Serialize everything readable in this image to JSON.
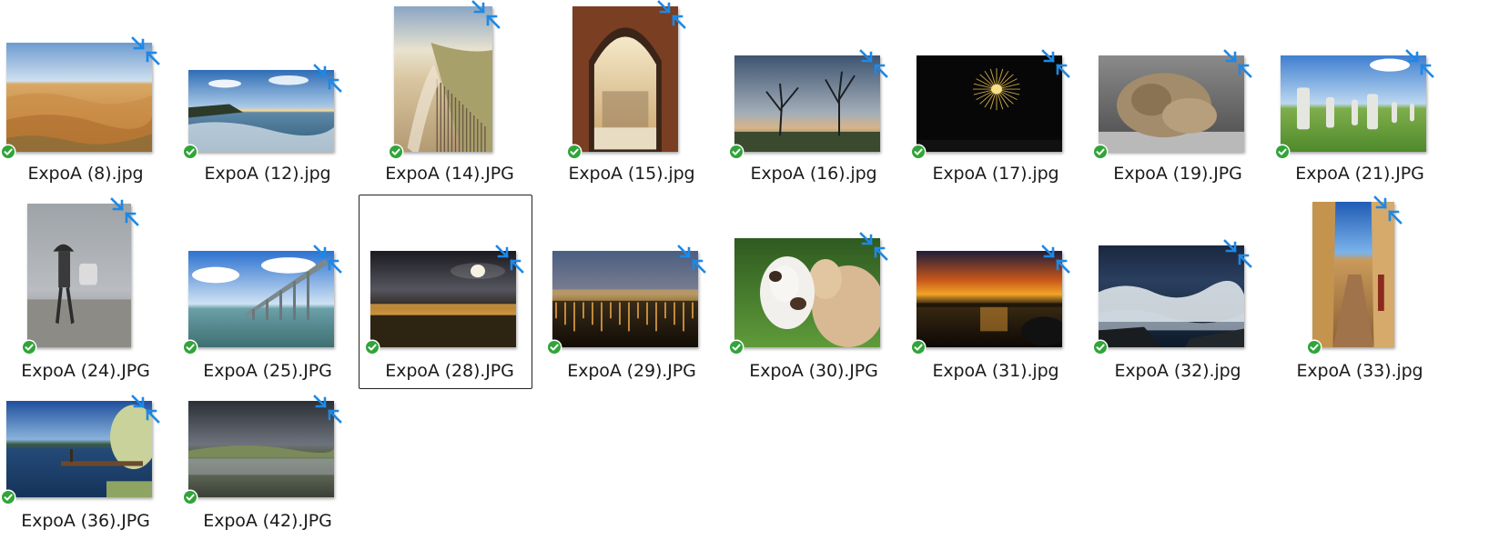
{
  "window": {
    "view": "Large icons"
  },
  "icons": {
    "overlay": "compress-arrows-icon",
    "status": "synced-check-icon",
    "overlay_color": "#1e88e5",
    "status_color": "#31a43a"
  },
  "files": [
    {
      "name": "ExpoA (8).jpg",
      "scene": "desert"
    },
    {
      "name": "ExpoA (12).jpg",
      "scene": "sea-cliff"
    },
    {
      "name": "ExpoA (14).JPG",
      "scene": "dune-fence"
    },
    {
      "name": "ExpoA (15).jpg",
      "scene": "arch-interior"
    },
    {
      "name": "ExpoA (16).jpg",
      "scene": "trees-fog"
    },
    {
      "name": "ExpoA (17).jpg",
      "scene": "fireworks"
    },
    {
      "name": "ExpoA (19).JPG",
      "scene": "monkey"
    },
    {
      "name": "ExpoA (21).JPG",
      "scene": "statues-field"
    },
    {
      "name": "ExpoA (24).JPG",
      "scene": "rain-walker"
    },
    {
      "name": "ExpoA (25).JPG",
      "scene": "bridge"
    },
    {
      "name": "ExpoA (28).JPG",
      "scene": "night-town",
      "selected": true
    },
    {
      "name": "ExpoA (29).JPG",
      "scene": "night-harbor"
    },
    {
      "name": "ExpoA (30).JPG",
      "scene": "cows"
    },
    {
      "name": "ExpoA (31).jpg",
      "scene": "sunset-lake"
    },
    {
      "name": "ExpoA (32).jpg",
      "scene": "waves"
    },
    {
      "name": "ExpoA (33).jpg",
      "scene": "alley"
    },
    {
      "name": "ExpoA (36).JPG",
      "scene": "lake-pier"
    },
    {
      "name": "ExpoA (42).JPG",
      "scene": "storm-shore"
    }
  ]
}
